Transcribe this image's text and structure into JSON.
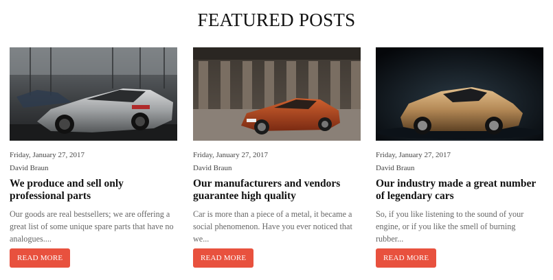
{
  "section": {
    "title": "FEATURED POSTS"
  },
  "posts": [
    {
      "date": "Friday, January 27, 2017",
      "author": "David Braun",
      "title": "We produce and sell only professional parts",
      "excerpt": "Our goods are real bestsellers; we are offering a great list of some unique spare parts that have no analogues....",
      "button": "READ MORE",
      "image_icon": "silver-coupe-photo"
    },
    {
      "date": "Friday, January 27, 2017",
      "author": "David Braun",
      "title": "Our manufacturers and vendors guarantee high quality",
      "excerpt": "Car is more than a piece of a metal, it became a social phenomenon.  Have you ever noticed that we...",
      "button": "READ MORE",
      "image_icon": "red-coupe-arena-photo"
    },
    {
      "date": "Friday, January 27, 2017",
      "author": "David Braun",
      "title": "Our industry made a great number of legendary cars",
      "excerpt": "So, if you like listening to the sound of your engine, or if you like the smell of burning rubber...",
      "button": "READ MORE",
      "image_icon": "gold-sports-car-photo"
    }
  ],
  "colors": {
    "button_bg": "#e8513e",
    "button_text": "#ffffff",
    "title_text": "#111111",
    "excerpt_text": "#666666"
  }
}
